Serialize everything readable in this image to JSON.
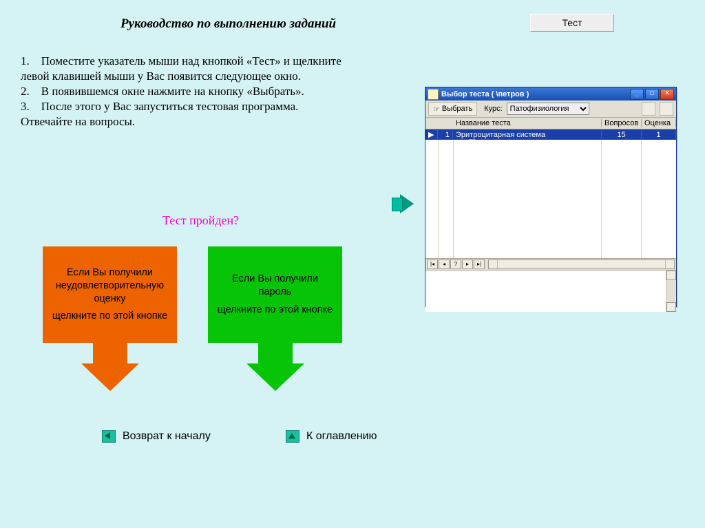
{
  "title": "Руководство по выполнению заданий",
  "test_button": "Тест",
  "instructions": {
    "l1": "1. Поместите указатель мыши над кнопкой «Тест» и щелкните",
    "l2": "левой клавишей мыши у Вас появится следующее окно.",
    "l3": "2. В появившемся окне нажмите на кнопку «Выбрать».",
    "l4": "3. После этого у Вас запуститься тестовая программа.",
    "l5": "Отвечайте на вопросы."
  },
  "question": "Тест пройден?",
  "fail_arrow": {
    "line1": "Если Вы получили",
    "line2": "неудовлетворительную",
    "line3": "оценку",
    "line4": "щелкните по этой кнопке"
  },
  "pass_arrow": {
    "line1": "Если Вы получили",
    "line2": "пароль",
    "line3": "щелкните по этой кнопке"
  },
  "nav": {
    "back": "Возврат к началу",
    "toc": "К оглавлению"
  },
  "win": {
    "title": "Выбор теста  ( \\петров )",
    "choose_btn": "Выбрать",
    "course_label": "Курс:",
    "course_value": "Патофизиология",
    "columns": {
      "name": "Название теста",
      "questions": "Вопросов",
      "grade": "Оценка"
    },
    "row": {
      "num": "1",
      "name": "Эритроцитарная система",
      "questions": "15",
      "grade": "1"
    }
  }
}
